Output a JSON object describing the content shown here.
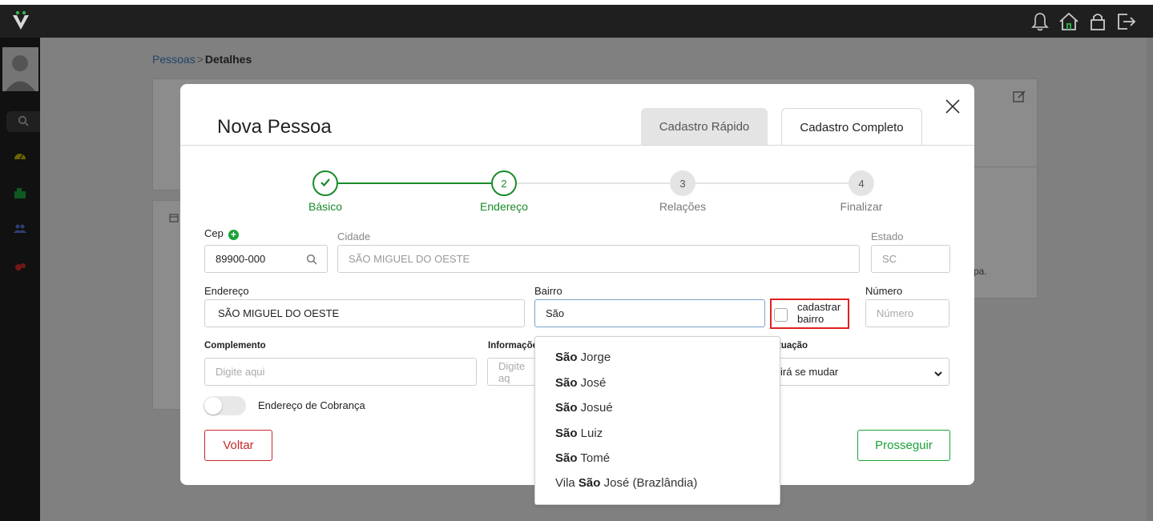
{
  "breadcrumb": {
    "parent": "Pessoas",
    "separator": ">",
    "current": "Detalhes"
  },
  "background": {
    "snippet": "pa."
  },
  "modal": {
    "title": "Nova Pessoa",
    "tabs": [
      {
        "label": "Cadastro Rápido",
        "active": false
      },
      {
        "label": "Cadastro Completo",
        "active": true
      }
    ]
  },
  "stepper": {
    "steps": [
      {
        "number": "✓",
        "label": "Básico",
        "state": "done"
      },
      {
        "number": "2",
        "label": "Endereço",
        "state": "current"
      },
      {
        "number": "3",
        "label": "Relações",
        "state": "pending"
      },
      {
        "number": "4",
        "label": "Finalizar",
        "state": "pending"
      }
    ]
  },
  "form": {
    "cep": {
      "label": "Cep",
      "value": "89900-000"
    },
    "cidade": {
      "label": "Cidade",
      "value": "SÃO MIGUEL DO OESTE"
    },
    "estado": {
      "label": "Estado",
      "value": "SC"
    },
    "endereco": {
      "label": "Endereço",
      "value": "SÃO MIGUEL DO OESTE"
    },
    "bairro": {
      "label": "Bairro",
      "value": "São"
    },
    "cadastrar_bairro": {
      "line1": "cadastrar",
      "line2": "bairro",
      "checked": false
    },
    "numero": {
      "label": "Número",
      "placeholder": "Número"
    },
    "complemento": {
      "label": "Complemento",
      "placeholder": "Digite aqui"
    },
    "informacoes": {
      "label": "Informaçõe",
      "placeholder": "Digite aq"
    },
    "situacao": {
      "label": "tuação",
      "value": "irá se mudar"
    },
    "cobranca": {
      "label": "Endereço de Cobrança",
      "on": false
    }
  },
  "buttons": {
    "back": "Voltar",
    "next": "Prosseguir"
  },
  "dropdown": {
    "items": [
      {
        "bold": "São",
        "rest": " Jorge"
      },
      {
        "bold": "São",
        "rest": " José"
      },
      {
        "bold": "São",
        "rest": " Josué"
      },
      {
        "bold": "São",
        "rest": " Luiz"
      },
      {
        "bold": "São",
        "rest": " Tomé"
      },
      {
        "prefix": "Vila ",
        "bold": "São",
        "rest": " José (Brazlândia)"
      }
    ]
  },
  "colors": {
    "accent_green": "#1aa33a",
    "danger_red": "#c62828",
    "highlight_red": "#e02020",
    "topbar": "#1f1f1f"
  },
  "icons": [
    "logo-icon",
    "bell-icon",
    "home-icon",
    "lock-icon",
    "logout-icon",
    "search-icon",
    "dashboard-icon",
    "building-icon",
    "users-icon",
    "settings-icon",
    "close-icon",
    "plus-icon",
    "edit-icon",
    "calendar-icon",
    "check-icon",
    "chevron-down-icon"
  ]
}
